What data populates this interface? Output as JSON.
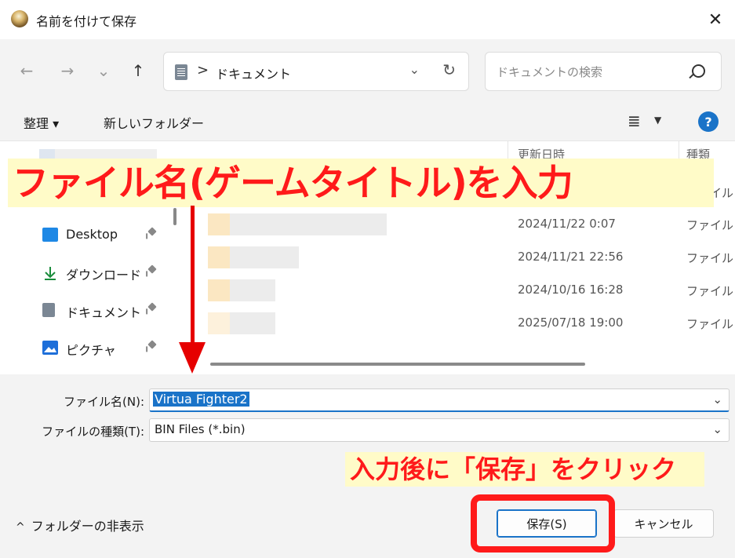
{
  "window": {
    "title": "名前を付けて保存",
    "close_symbol": "✕"
  },
  "nav": {
    "back_symbol": "←",
    "forward_symbol": "→",
    "recent_symbol": "⌄",
    "up_symbol": "↑",
    "address_separator": ">",
    "address_text": "ドキュメント",
    "address_dropdown_symbol": "⌄",
    "refresh_symbol": "↻",
    "search_placeholder": "ドキュメントの検索"
  },
  "toolbar": {
    "organize_label": "整理 ▾",
    "new_folder_label": "新しいフォルダー",
    "view_symbol": "≣",
    "view_caret": "▼",
    "help_symbol": "?"
  },
  "navpane": {
    "items": [
      {
        "label": "Desktop"
      },
      {
        "label": "ダウンロード"
      },
      {
        "label": "ドキュメント"
      },
      {
        "label": "ピクチャ"
      }
    ]
  },
  "filelist": {
    "header_date": "更新日時",
    "header_type": "種類",
    "rows": [
      {
        "date": "",
        "type": "ファイル フ"
      },
      {
        "date": "2024/11/22 0:07",
        "type": "ファイル フ"
      },
      {
        "date": "2024/11/21 22:56",
        "type": "ファイル フ"
      },
      {
        "date": "2024/10/16 16:28",
        "type": "ファイル フ"
      },
      {
        "date": "2025/07/18 19:00",
        "type": "ファイル フ"
      }
    ]
  },
  "form": {
    "filename_label": "ファイル名(N):",
    "filename_value": "Virtua Fighter2",
    "filetype_label": "ファイルの種類(T):",
    "filetype_value": "BIN Files (*.bin)",
    "field_caret": "⌄",
    "hide_folders_caret": "^",
    "hide_folders_label": "フォルダーの非表示",
    "save_label": "保存(S)",
    "cancel_label": "キャンセル"
  },
  "annotations": {
    "main": "ファイル名(ゲームタイトル)を入力",
    "sub": "入力後に「保存」をクリック",
    "color": "#ff1a1a",
    "highlight": "#fffbc8"
  }
}
